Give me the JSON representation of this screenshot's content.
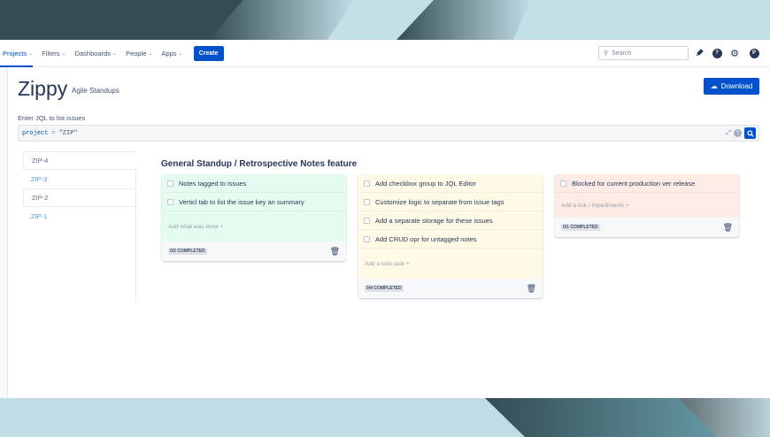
{
  "nav": {
    "items": [
      {
        "label": "Projects",
        "active": true
      },
      {
        "label": "Filters"
      },
      {
        "label": "Dashboards"
      },
      {
        "label": "People"
      },
      {
        "label": "Apps"
      }
    ],
    "create_label": "Create",
    "search_placeholder": "Search",
    "avatar_initial": "P"
  },
  "header": {
    "title": "Zippy",
    "subtitle": "Agile Standups",
    "download_label": "Download"
  },
  "jql": {
    "label": "Enter JQL to list issues",
    "keyword": "project",
    "operator": "=",
    "value": "\"ZIP\""
  },
  "issues": [
    "ZIP-4",
    "ZIP-3",
    "ZIP-2",
    "ZIP-1"
  ],
  "section_title": "General Standup / Retrospective Notes feature",
  "cards": [
    {
      "color": "#e3fcef",
      "items": [
        "Notes tagged to issues",
        "Verticl tab to list the issue key an summary"
      ],
      "add_label": "Add what was done +",
      "status": "0/2 COMPLETED"
    },
    {
      "color": "#fffae6",
      "items": [
        "Add checkbox group to JQL Editor",
        "Customize logic to separate from issue tags",
        "Add a separate storage for these issues",
        "Add CRUD opr for untagged notes"
      ],
      "add_label": "Add a todo task +",
      "status": "0/4 COMPLETED"
    },
    {
      "color": "#ffebe6",
      "items": [
        "Blocked for current production ver release"
      ],
      "add_label": "Add a risk / impediments +",
      "status": "0/1 COMPLETED"
    }
  ]
}
